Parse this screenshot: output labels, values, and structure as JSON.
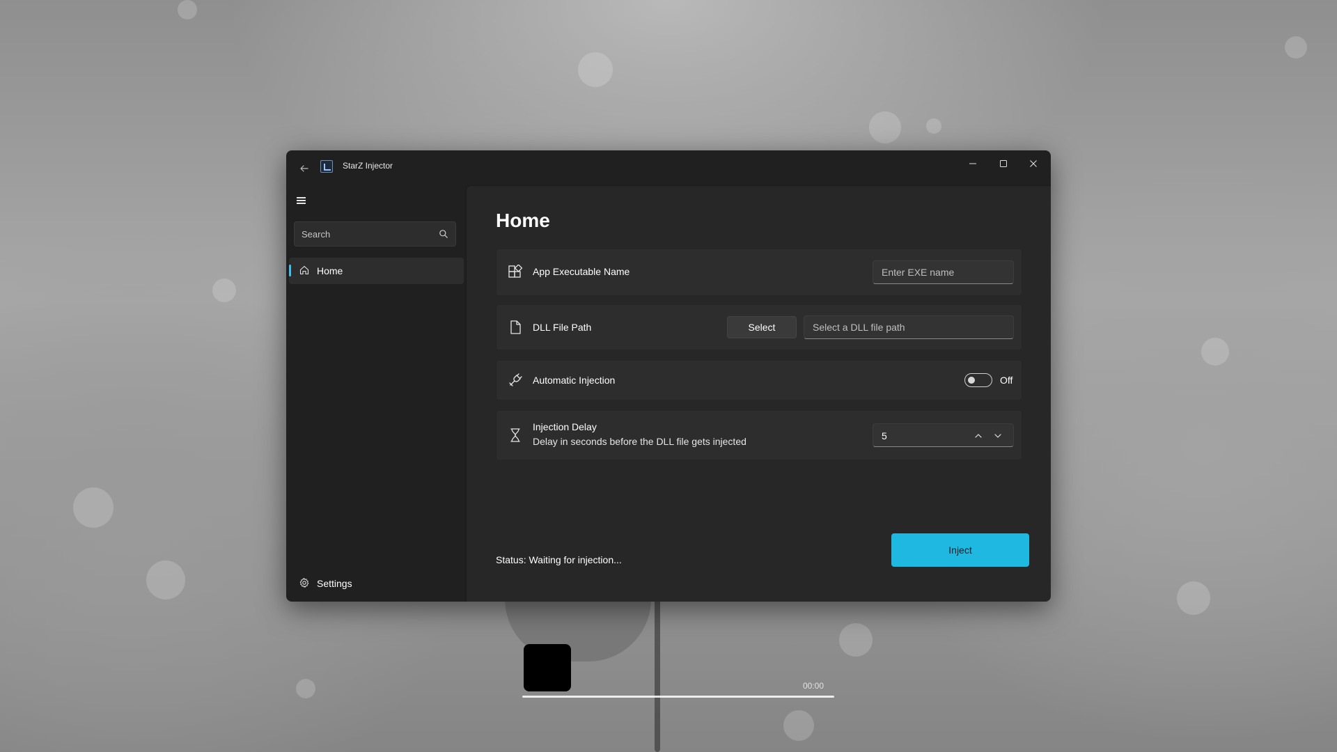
{
  "window": {
    "title": "StarZ Injector",
    "accent_color": "#1fb8e0"
  },
  "sidebar": {
    "search_placeholder": "Search",
    "items": [
      {
        "label": "Home",
        "icon": "home-icon",
        "selected": true
      }
    ],
    "footer": {
      "label": "Settings",
      "icon": "gear-icon"
    }
  },
  "main": {
    "page_title": "Home",
    "exe_card": {
      "label": "App Executable Name",
      "icon": "apps-icon",
      "input_placeholder": "Enter EXE name",
      "input_value": ""
    },
    "dll_card": {
      "label": "DLL File Path",
      "icon": "file-icon",
      "select_label": "Select",
      "input_placeholder": "Select a DLL file path",
      "input_value": ""
    },
    "auto_card": {
      "label": "Automatic Injection",
      "icon": "plug-icon",
      "toggle_state": "Off",
      "enabled": false
    },
    "delay_card": {
      "label": "Injection Delay",
      "description": "Delay in seconds before the DLL file gets injected",
      "icon": "hourglass-icon",
      "value": "5"
    },
    "status": "Status: Waiting for injection...",
    "inject_label": "Inject"
  },
  "media": {
    "time": "00:00"
  }
}
